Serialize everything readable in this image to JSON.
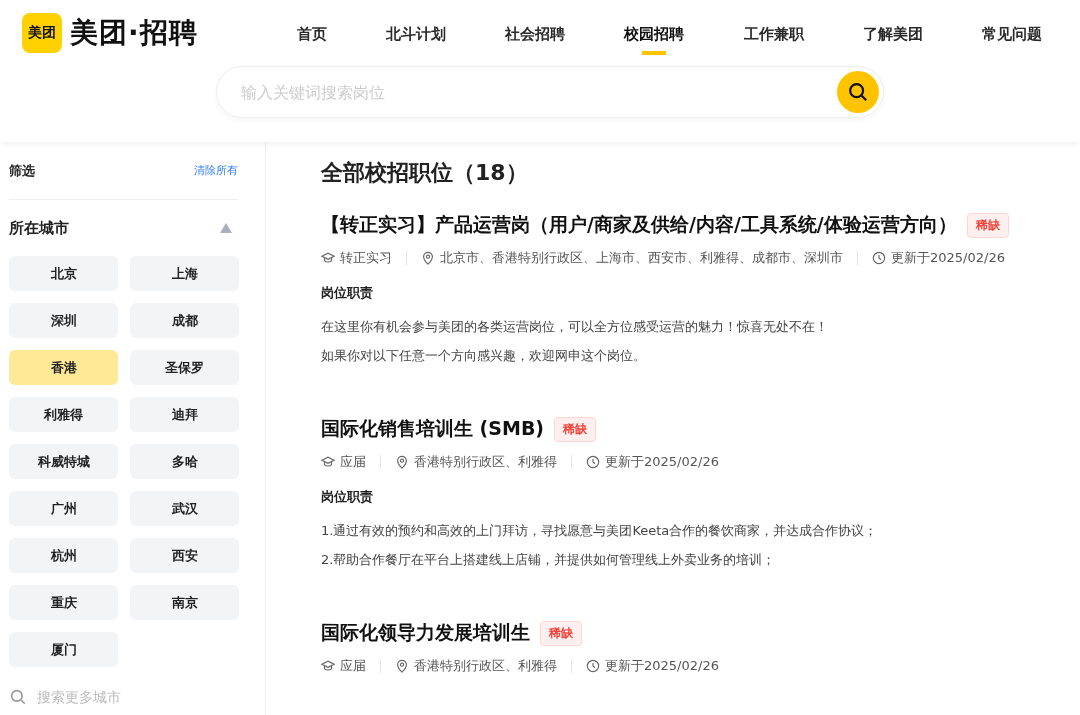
{
  "logo": {
    "mark": "美团",
    "text": "美团·招聘"
  },
  "nav": [
    {
      "label": "首页",
      "selected": false
    },
    {
      "label": "北斗计划",
      "selected": false
    },
    {
      "label": "社会招聘",
      "selected": false
    },
    {
      "label": "校园招聘",
      "selected": true
    },
    {
      "label": "工作兼职",
      "selected": false
    },
    {
      "label": "了解美团",
      "selected": false
    },
    {
      "label": "常见问题",
      "selected": false
    }
  ],
  "search": {
    "placeholder": "输入关键词搜索岗位"
  },
  "filter": {
    "title": "筛选",
    "clear": "清除所有",
    "section": "所在城市",
    "expanded": true,
    "cities": [
      {
        "label": "北京",
        "selected": false
      },
      {
        "label": "上海",
        "selected": false
      },
      {
        "label": "深圳",
        "selected": false
      },
      {
        "label": "成都",
        "selected": false
      },
      {
        "label": "香港",
        "selected": true
      },
      {
        "label": "圣保罗",
        "selected": false
      },
      {
        "label": "利雅得",
        "selected": false
      },
      {
        "label": "迪拜",
        "selected": false
      },
      {
        "label": "科威特城",
        "selected": false
      },
      {
        "label": "多哈",
        "selected": false
      },
      {
        "label": "广州",
        "selected": false
      },
      {
        "label": "武汉",
        "selected": false
      },
      {
        "label": "杭州",
        "selected": false
      },
      {
        "label": "西安",
        "selected": false
      },
      {
        "label": "重庆",
        "selected": false
      },
      {
        "label": "南京",
        "selected": false
      },
      {
        "label": "厦门",
        "selected": false
      }
    ],
    "city_search": {
      "placeholder": "搜索更多城市"
    }
  },
  "heading": "全部校招职位（18）",
  "jobs": [
    {
      "title": "【转正实习】产品运营岗（用户/商家及供给/内容/工具系统/体验运营方向）",
      "tag": "稀缺",
      "type": "转正实习",
      "locations": "北京市、香港特别行政区、上海市、西安市、利雅得、成都市、深圳市",
      "updated": "更新于2025/02/26",
      "duty_label": "岗位职责",
      "lines": [
        "在这里你有机会参与美团的各类运营岗位，可以全方位感受运营的魅力！惊喜无处不在！",
        "如果你对以下任意一个方向感兴趣，欢迎网申这个岗位。"
      ]
    },
    {
      "title": "国际化销售培训生 (SMB)",
      "tag": "稀缺",
      "type": "应届",
      "locations": "香港特别行政区、利雅得",
      "updated": "更新于2025/02/26",
      "duty_label": "岗位职责",
      "lines": [
        "1.通过有效的预约和高效的上门拜访，寻找愿意与美团Keeta合作的餐饮商家，并达成合作协议；",
        "2.帮助合作餐厅在平台上搭建线上店铺，并提供如何管理线上外卖业务的培训；"
      ]
    },
    {
      "title": "国际化领导力发展培训生",
      "tag": "稀缺",
      "type": "应届",
      "locations": "香港特别行政区、利雅得",
      "updated": "更新于2025/02/26"
    }
  ]
}
